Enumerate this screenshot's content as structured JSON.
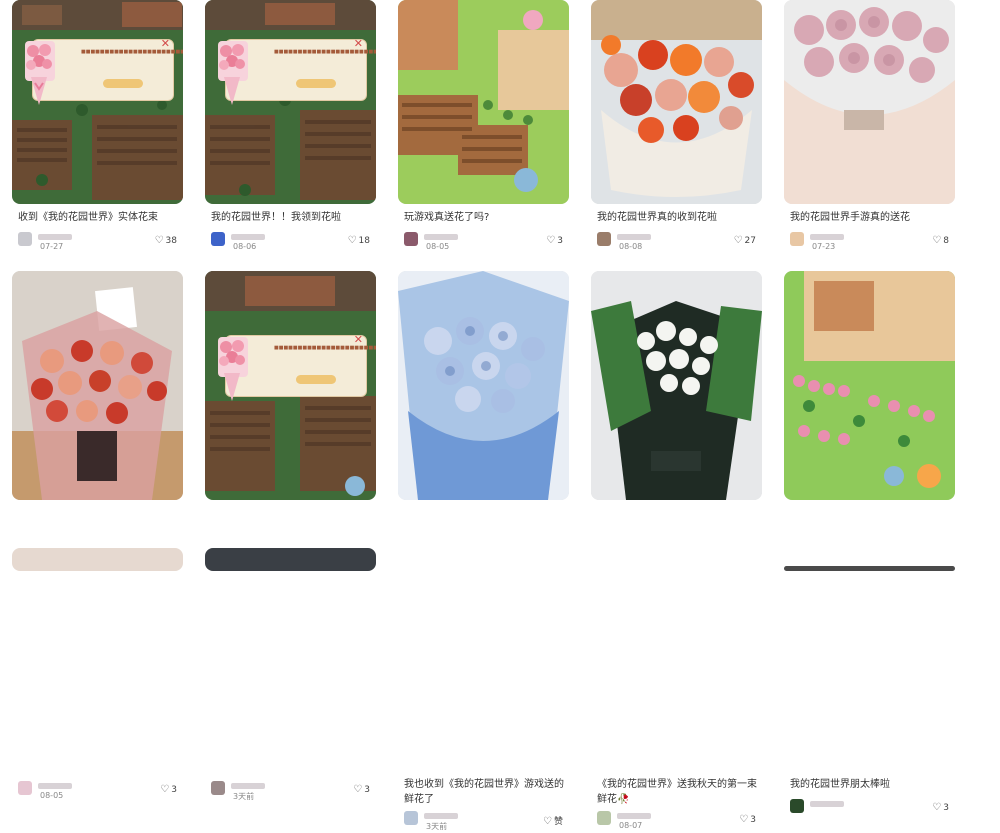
{
  "feed": {
    "cards": [
      {
        "title": "收到《我的花园世界》实体花束",
        "date": "07-27",
        "likes": "38"
      },
      {
        "title": "我的花园世界！！我领到花啦",
        "date": "08-06",
        "likes": "18"
      },
      {
        "title": "玩游戏真送花了吗?",
        "date": "08-05",
        "likes": "3"
      },
      {
        "title": "我的花园世界真的收到花啦",
        "date": "08-08",
        "likes": "27"
      },
      {
        "title": "我的花园世界手游真的送花",
        "date": "07-23",
        "likes": "8"
      },
      {
        "title": "",
        "date": "08-05",
        "likes": "3"
      },
      {
        "title": "",
        "date": "3天前",
        "likes": "3"
      },
      {
        "title": "我也收到《我的花园世界》游戏送的鲜花了",
        "date": "3天前",
        "likes": "赞"
      },
      {
        "title": "《我的花园世界》送我秋天的第一束鲜花🥀",
        "date": "08-07",
        "likes": "3"
      },
      {
        "title": "我的花园世界朋太棒啦",
        "date": "",
        "likes": "3"
      }
    ],
    "heart_icon": "heart-icon",
    "colors": {
      "background": "#ffffff",
      "title_text": "#333333",
      "meta_text": "#888888",
      "popup_bg": "#f4ecd8",
      "popup_button": "#efc676"
    }
  }
}
